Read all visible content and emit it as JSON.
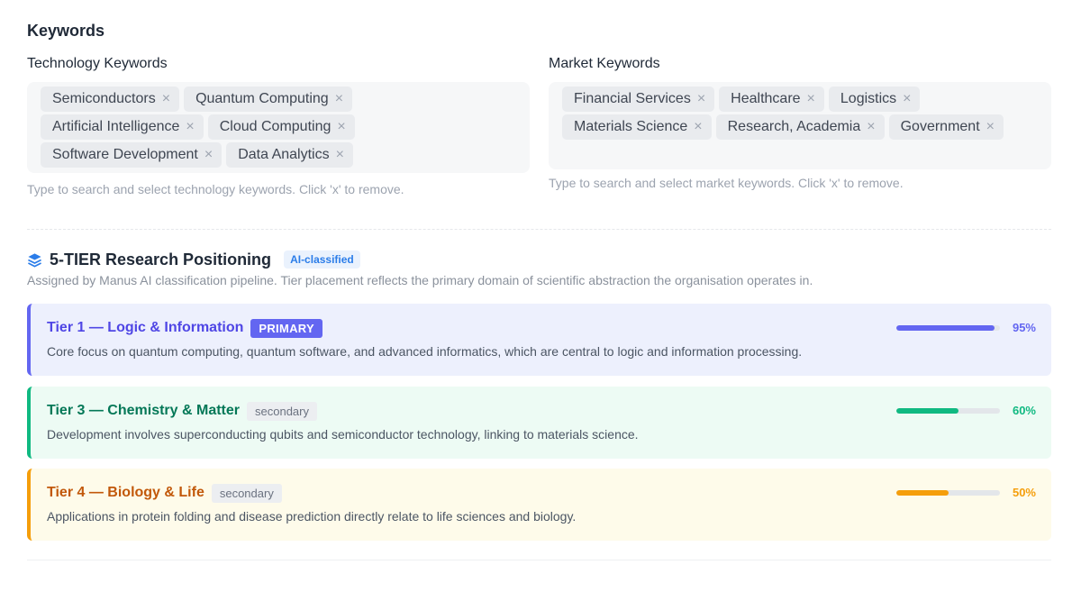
{
  "keywords": {
    "title": "Keywords",
    "technology": {
      "label": "Technology Keywords",
      "chips": [
        "Semiconductors",
        "Quantum Computing",
        "Artificial Intelligence",
        "Cloud Computing",
        "Software Development",
        "Data Analytics"
      ],
      "help": "Type to search and select technology keywords. Click 'x' to remove."
    },
    "market": {
      "label": "Market Keywords",
      "chips": [
        "Financial Services",
        "Healthcare",
        "Logistics",
        "Materials Science",
        "Research, Academia",
        "Government"
      ],
      "help": "Type to search and select market keywords. Click 'x' to remove."
    },
    "remove_glyph": "×"
  },
  "tiers": {
    "icon": "layers-icon",
    "title": "5-TIER Research Positioning",
    "badge": "AI-classified",
    "subtitle": "Assigned by Manus AI classification pipeline. Tier placement reflects the primary domain of scientific abstraction the organisation operates in.",
    "items": [
      {
        "name": "Tier 1 — Logic & Information",
        "badge": "PRIMARY",
        "badge_type": "primary",
        "description": "Core focus on quantum computing, quantum software, and advanced informatics, which are central to logic and information processing.",
        "progress": 95,
        "progress_label": "95%",
        "color": "#6366f1"
      },
      {
        "name": "Tier 3 — Chemistry & Matter",
        "badge": "secondary",
        "badge_type": "secondary",
        "description": "Development involves superconducting qubits and semiconductor technology, linking to materials science.",
        "progress": 60,
        "progress_label": "60%",
        "color": "#10b981"
      },
      {
        "name": "Tier 4 — Biology & Life",
        "badge": "secondary",
        "badge_type": "secondary",
        "description": "Applications in protein folding and disease prediction directly relate to life sciences and biology.",
        "progress": 50,
        "progress_label": "50%",
        "color": "#f59e0b"
      }
    ]
  }
}
